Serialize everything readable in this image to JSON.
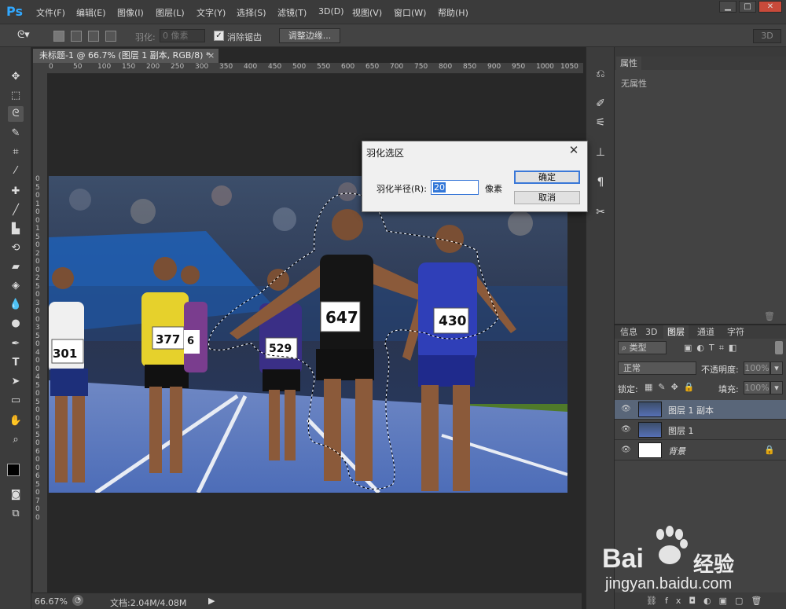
{
  "app": {
    "logo": "Ps",
    "workspace": "3D"
  },
  "menu": [
    "文件(F)",
    "编辑(E)",
    "图像(I)",
    "图层(L)",
    "文字(Y)",
    "选择(S)",
    "滤镜(T)",
    "3D(D)",
    "视图(V)",
    "窗口(W)",
    "帮助(H)"
  ],
  "window_buttons": [
    "▁",
    "□",
    "✕"
  ],
  "options": {
    "feather_label": "羽化:",
    "feather_placeholder": "0 像素",
    "antialias_label": "消除锯齿",
    "refine_edge": "调整边缘..."
  },
  "document": {
    "tab_title": "未标题-1 @ 66.7% (图层 1 副本, RGB/8) *",
    "ruler_top": [
      "0",
      "50",
      "100",
      "150",
      "200",
      "250",
      "300",
      "350",
      "400",
      "450",
      "500",
      "550",
      "600",
      "650",
      "700",
      "750",
      "800",
      "850",
      "900",
      "950",
      "1000",
      "1050"
    ],
    "ruler_left": [
      "0",
      "5",
      "0",
      "1",
      "0",
      "0",
      "1",
      "5",
      "0",
      "2",
      "0",
      "0",
      "2",
      "5",
      "0",
      "3",
      "0",
      "0",
      "3",
      "5",
      "0",
      "4",
      "0",
      "0",
      "4",
      "5",
      "0",
      "5",
      "0",
      "0",
      "5",
      "5",
      "0",
      "6",
      "0",
      "0",
      "6",
      "5",
      "0",
      "7",
      "0",
      "0"
    ],
    "bibs": [
      "301",
      "377",
      "6",
      "529",
      "647",
      "430"
    ]
  },
  "status": {
    "zoom": "66.67%",
    "doc": "文档:2.04M/4.08M"
  },
  "properties": {
    "tab": "属性",
    "empty": "无属性"
  },
  "layers_panel": {
    "tabs": [
      "信息",
      "3D",
      "图层",
      "通道",
      "字符"
    ],
    "filter_kind": "类型",
    "blend_mode": "正常",
    "opacity_label": "不透明度:",
    "opacity_value": "100%",
    "lock_label": "锁定:",
    "fill_label": "填充:",
    "fill_value": "100%",
    "layers": [
      {
        "name": "图层 1 副本",
        "selected": true
      },
      {
        "name": "图层 1",
        "selected": false
      },
      {
        "name": "背景",
        "selected": false,
        "locked": true
      }
    ]
  },
  "dialog": {
    "title": "羽化选区",
    "radius_label": "羽化半径(R):",
    "radius_value": "20",
    "unit": "像素",
    "ok": "确定",
    "cancel": "取消"
  },
  "watermark": {
    "brand": "Bai",
    "brand2": "经验",
    "url": "jingyan.baidu.com"
  }
}
